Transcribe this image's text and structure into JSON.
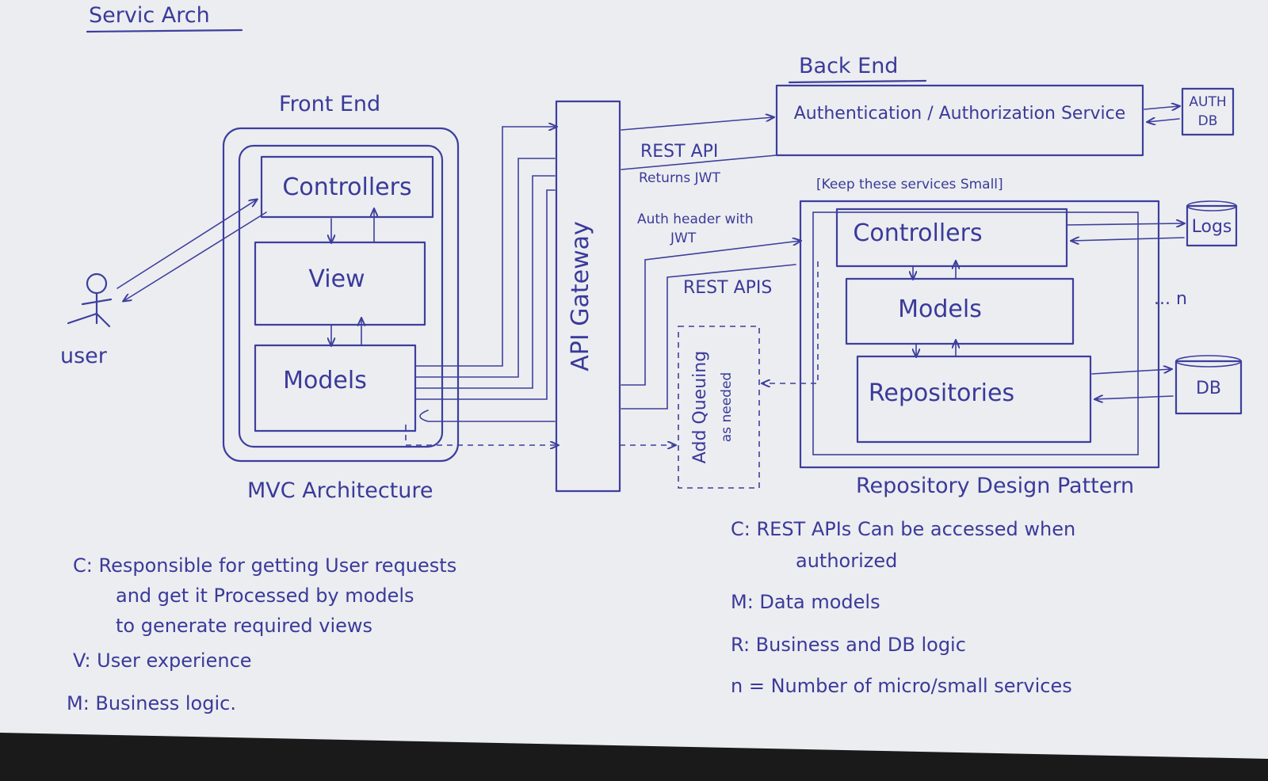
{
  "title": "Servic Arch",
  "frontend": {
    "heading": "Front End",
    "controllers": "Controllers",
    "view": "View",
    "models": "Models",
    "caption": "MVC Architecture"
  },
  "user_label": "user",
  "gateway_label": "API Gateway",
  "queue_label_1": "Add Queuing",
  "queue_label_2": "as needed",
  "backend": {
    "heading": "Back End",
    "auth_service": "Authentication / Authorization Service",
    "auth_db": [
      "AUTH",
      "DB"
    ],
    "rest_api": "REST API",
    "returns_jwt": "Returns JWT",
    "keep_small": "[Keep these services Small]",
    "auth_header_1": "Auth header with",
    "auth_header_2": "JWT",
    "rest_apis": "REST APIS",
    "controllers": "Controllers",
    "models": "Models",
    "repositories": "Repositories",
    "logs": "Logs",
    "db": "DB",
    "more": "... n",
    "caption": "Repository Design Pattern"
  },
  "notes_left": [
    "C: Responsible for getting User requests",
    "and get it Processed by models",
    "to generate required views",
    "V: User experience",
    "M: Business logic."
  ],
  "notes_right": [
    "C: REST APIs Can be accessed when",
    "authorized",
    "M: Data models",
    "R: Business and DB logic",
    "n = Number of micro/small services"
  ]
}
